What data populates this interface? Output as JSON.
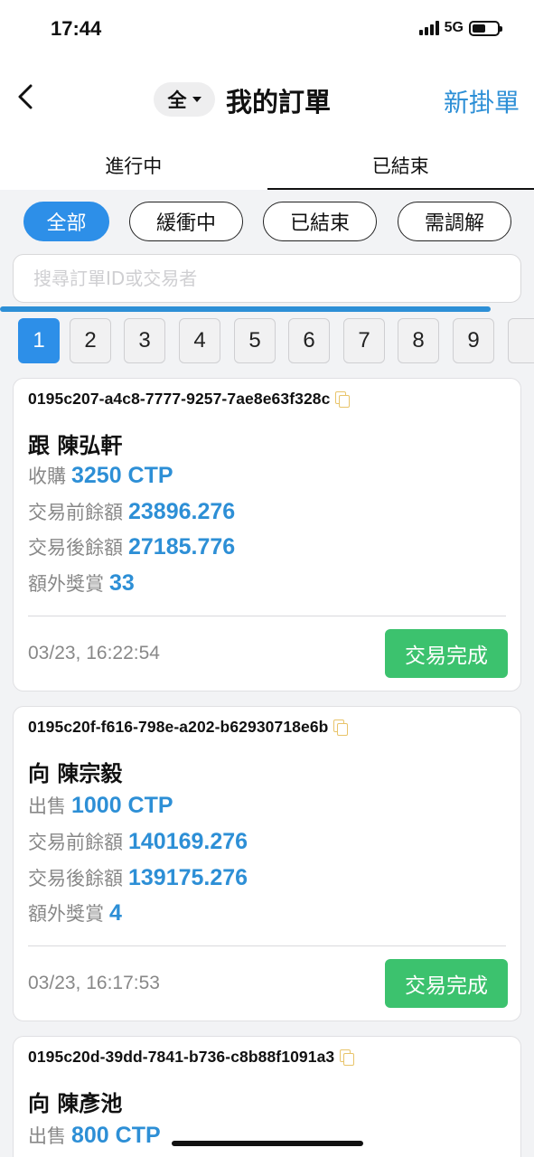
{
  "status_bar": {
    "time": "17:44",
    "network": "5G"
  },
  "nav": {
    "filter_label": "全",
    "title": "我的訂單",
    "new_order_label": "新掛單"
  },
  "tabs": [
    {
      "label": "進行中",
      "active": false
    },
    {
      "label": "已結束",
      "active": true
    }
  ],
  "chips": [
    {
      "label": "全部",
      "active": true
    },
    {
      "label": "緩衝中",
      "active": false
    },
    {
      "label": "已結束",
      "active": false
    },
    {
      "label": "需調解",
      "active": false
    }
  ],
  "search": {
    "placeholder": "搜尋訂單ID或交易者"
  },
  "pager": {
    "pages": [
      "1",
      "2",
      "3",
      "4",
      "5",
      "6",
      "7",
      "8",
      "9"
    ],
    "current": "1"
  },
  "orders": [
    {
      "id": "0195c207-a4c8-7777-9257-7ae8e63f328c",
      "counterparty": "跟 陳弘軒",
      "type_label": "收購",
      "amount": "3250 CTP",
      "before_label": "交易前餘額",
      "before_value": "23896.276",
      "after_label": "交易後餘額",
      "after_value": "27185.776",
      "bonus_label": "額外獎賞",
      "bonus_value": "33",
      "timestamp": "03/23, 16:22:54",
      "status": "交易完成"
    },
    {
      "id": "0195c20f-f616-798e-a202-b62930718e6b",
      "counterparty": "向 陳宗毅",
      "type_label": "出售",
      "amount": "1000 CTP",
      "before_label": "交易前餘額",
      "before_value": "140169.276",
      "after_label": "交易後餘額",
      "after_value": "139175.276",
      "bonus_label": "額外獎賞",
      "bonus_value": "4",
      "timestamp": "03/23, 16:17:53",
      "status": "交易完成"
    },
    {
      "id": "0195c20d-39dd-7841-b736-c8b88f1091a3",
      "counterparty": "向 陳彥池",
      "type_label": "出售",
      "amount": "800 CTP"
    }
  ],
  "colors": {
    "accent": "#2d8fd6",
    "success": "#3cc26e",
    "copy_icon": "#e8c46a"
  }
}
